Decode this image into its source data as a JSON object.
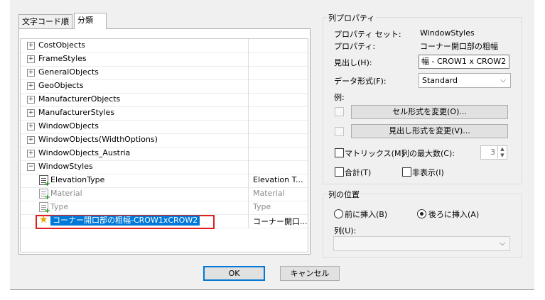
{
  "tabs": [
    {
      "label": "文字コード順"
    },
    {
      "label": "分類"
    }
  ],
  "tree": {
    "groups": [
      {
        "label": "CostObjects",
        "expander": "+"
      },
      {
        "label": "FrameStyles",
        "expander": "+"
      },
      {
        "label": "GeneralObjects",
        "expander": "+"
      },
      {
        "label": "GeoObjects",
        "expander": "+"
      },
      {
        "label": "ManufacturerObjects",
        "expander": "+"
      },
      {
        "label": "ManufacturerStyles",
        "expander": "+"
      },
      {
        "label": "WindowObjects",
        "expander": "+"
      },
      {
        "label": "WindowObjects(WidthOptions)",
        "expander": "+"
      },
      {
        "label": "WindowObjects_Austria",
        "expander": "+"
      },
      {
        "label": "WindowStyles",
        "expander": "−"
      }
    ],
    "children": [
      {
        "label": "ElevationType",
        "value": "Elevation T..."
      },
      {
        "label": "Material",
        "value": "Material"
      },
      {
        "label": "Type",
        "value": "Type"
      },
      {
        "label": "コーナー開口部の粗幅-CROW1xCROW2",
        "value": "コーナー開口..."
      }
    ]
  },
  "column_props": {
    "title": "列プロパティ",
    "property_set_label": "プロパティ セット:",
    "property_set_value": "WindowStyles",
    "property_label": "プロパティ:",
    "property_value": "コーナー開口部の粗幅",
    "heading_label": "見出し(H):",
    "heading_value": "幅 - CROW1 x CROW2",
    "format_label": "データ形式(F):",
    "format_value": "Standard",
    "example_label": "例:",
    "cell_format_button": "セル形式を変更(O)...",
    "heading_format_button": "見出し形式を変更(V)...",
    "matrix_label": "マトリックス(M)",
    "max_columns_label": "列の最大数(C):",
    "max_columns_value": "3",
    "total_label": "合計(T)",
    "hide_label": "非表示(I)"
  },
  "column_position": {
    "title": "列の位置",
    "insert_before": "前に挿入(B)",
    "insert_after": "後ろに挿入(A)",
    "column_label": "列(U):",
    "column_value": ""
  },
  "buttons": {
    "ok": "OK",
    "cancel": "キャンセル"
  }
}
